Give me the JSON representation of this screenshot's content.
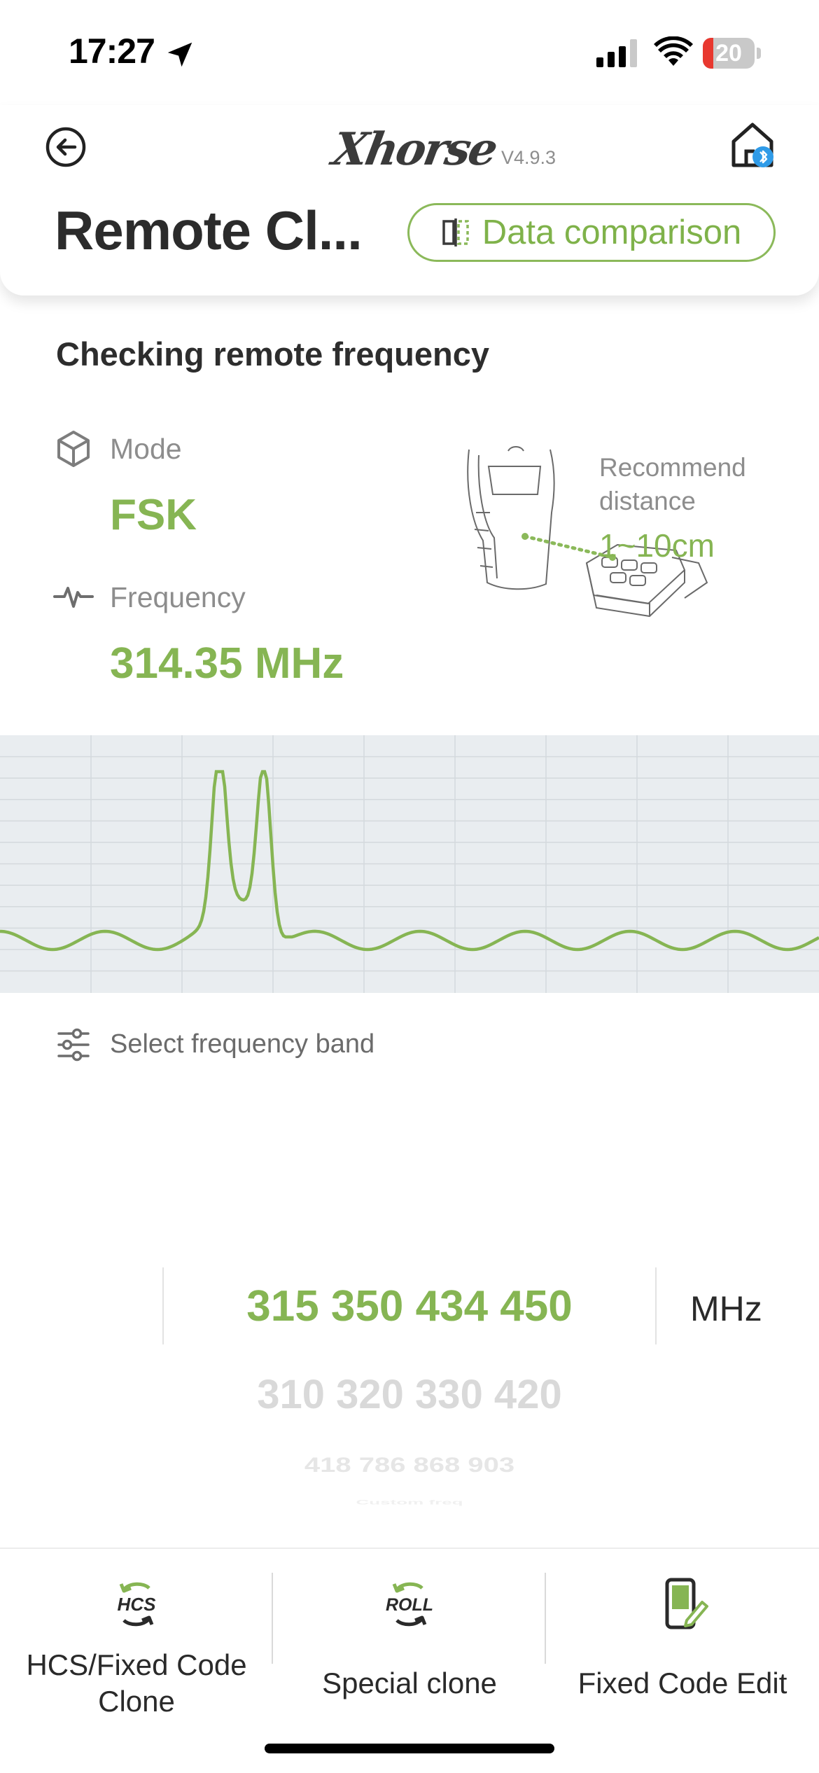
{
  "status_bar": {
    "time": "17:27",
    "battery_level": "20",
    "battery_fraction": 0.2
  },
  "header": {
    "logo": "Xhorse",
    "version": "V4.9.3",
    "title": "Remote Cl...",
    "data_comparison_label": "Data comparison"
  },
  "colors": {
    "accent_green": "#86b553",
    "chart_bg": "#e9edf0",
    "text_dark": "#2a2a2a",
    "text_gray": "#8d8d8d"
  },
  "check": {
    "section_title": "Checking remote frequency",
    "mode_label": "Mode",
    "mode_value": "FSK",
    "frequency_label": "Frequency",
    "frequency_value": "314.35 MHz",
    "recommend_label": "Recommend distance",
    "recommend_value": "1~10cm"
  },
  "band": {
    "label": "Select frequency band",
    "selected": "315 350 434 450",
    "options": [
      "310 320 330 420",
      "418 786 868 903",
      "Custom freq"
    ],
    "unit": "MHz"
  },
  "tabs": [
    {
      "icon": "hcs-icon",
      "label": "HCS/Fixed Code Clone"
    },
    {
      "icon": "roll-icon",
      "label": "Special clone"
    },
    {
      "icon": "edit-phone-icon",
      "label": "Fixed Code Edit"
    }
  ]
}
